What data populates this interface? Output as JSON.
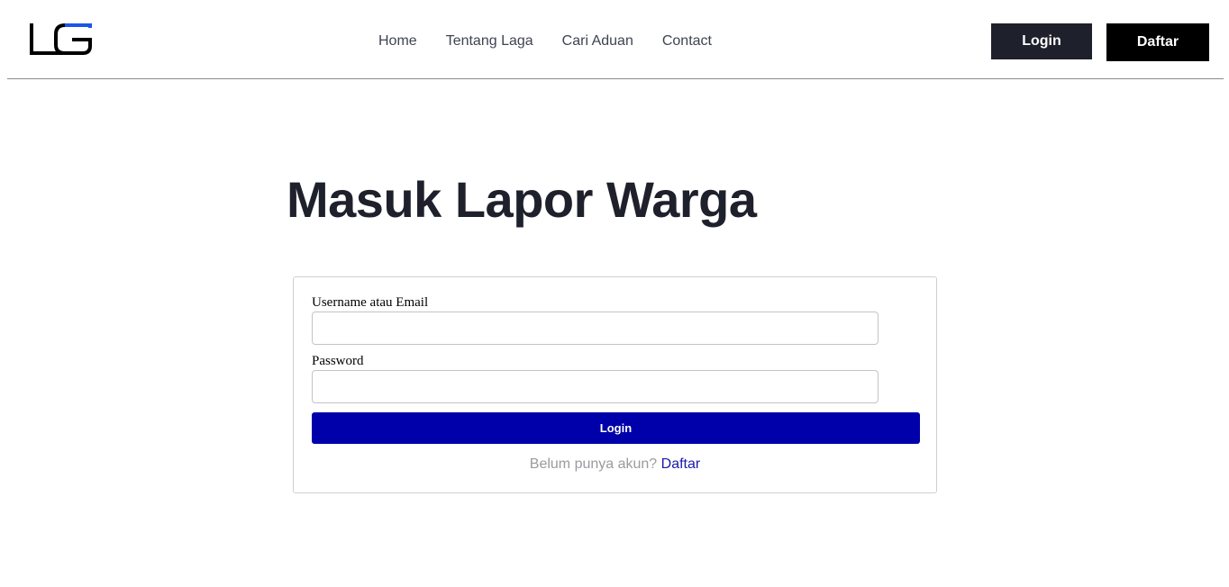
{
  "header": {
    "logo": {
      "icon": "lg-logo-icon",
      "accent_color": "#1a56e8"
    },
    "nav": [
      "Home",
      "Tentang Laga",
      "Cari Aduan",
      "Contact"
    ],
    "login_label": "Login",
    "daftar_label": "Daftar"
  },
  "main": {
    "title": "Masuk Lapor Warga",
    "form": {
      "username_label": "Username atau Email",
      "username_value": "",
      "password_label": "Password",
      "password_value": "",
      "submit_label": "Login",
      "signup_prompt": "Belum punya akun?",
      "signup_link": "Daftar"
    }
  },
  "colors": {
    "primary_button": "#0000aa",
    "dark_button": "#1e202b",
    "title": "#1e202b"
  }
}
